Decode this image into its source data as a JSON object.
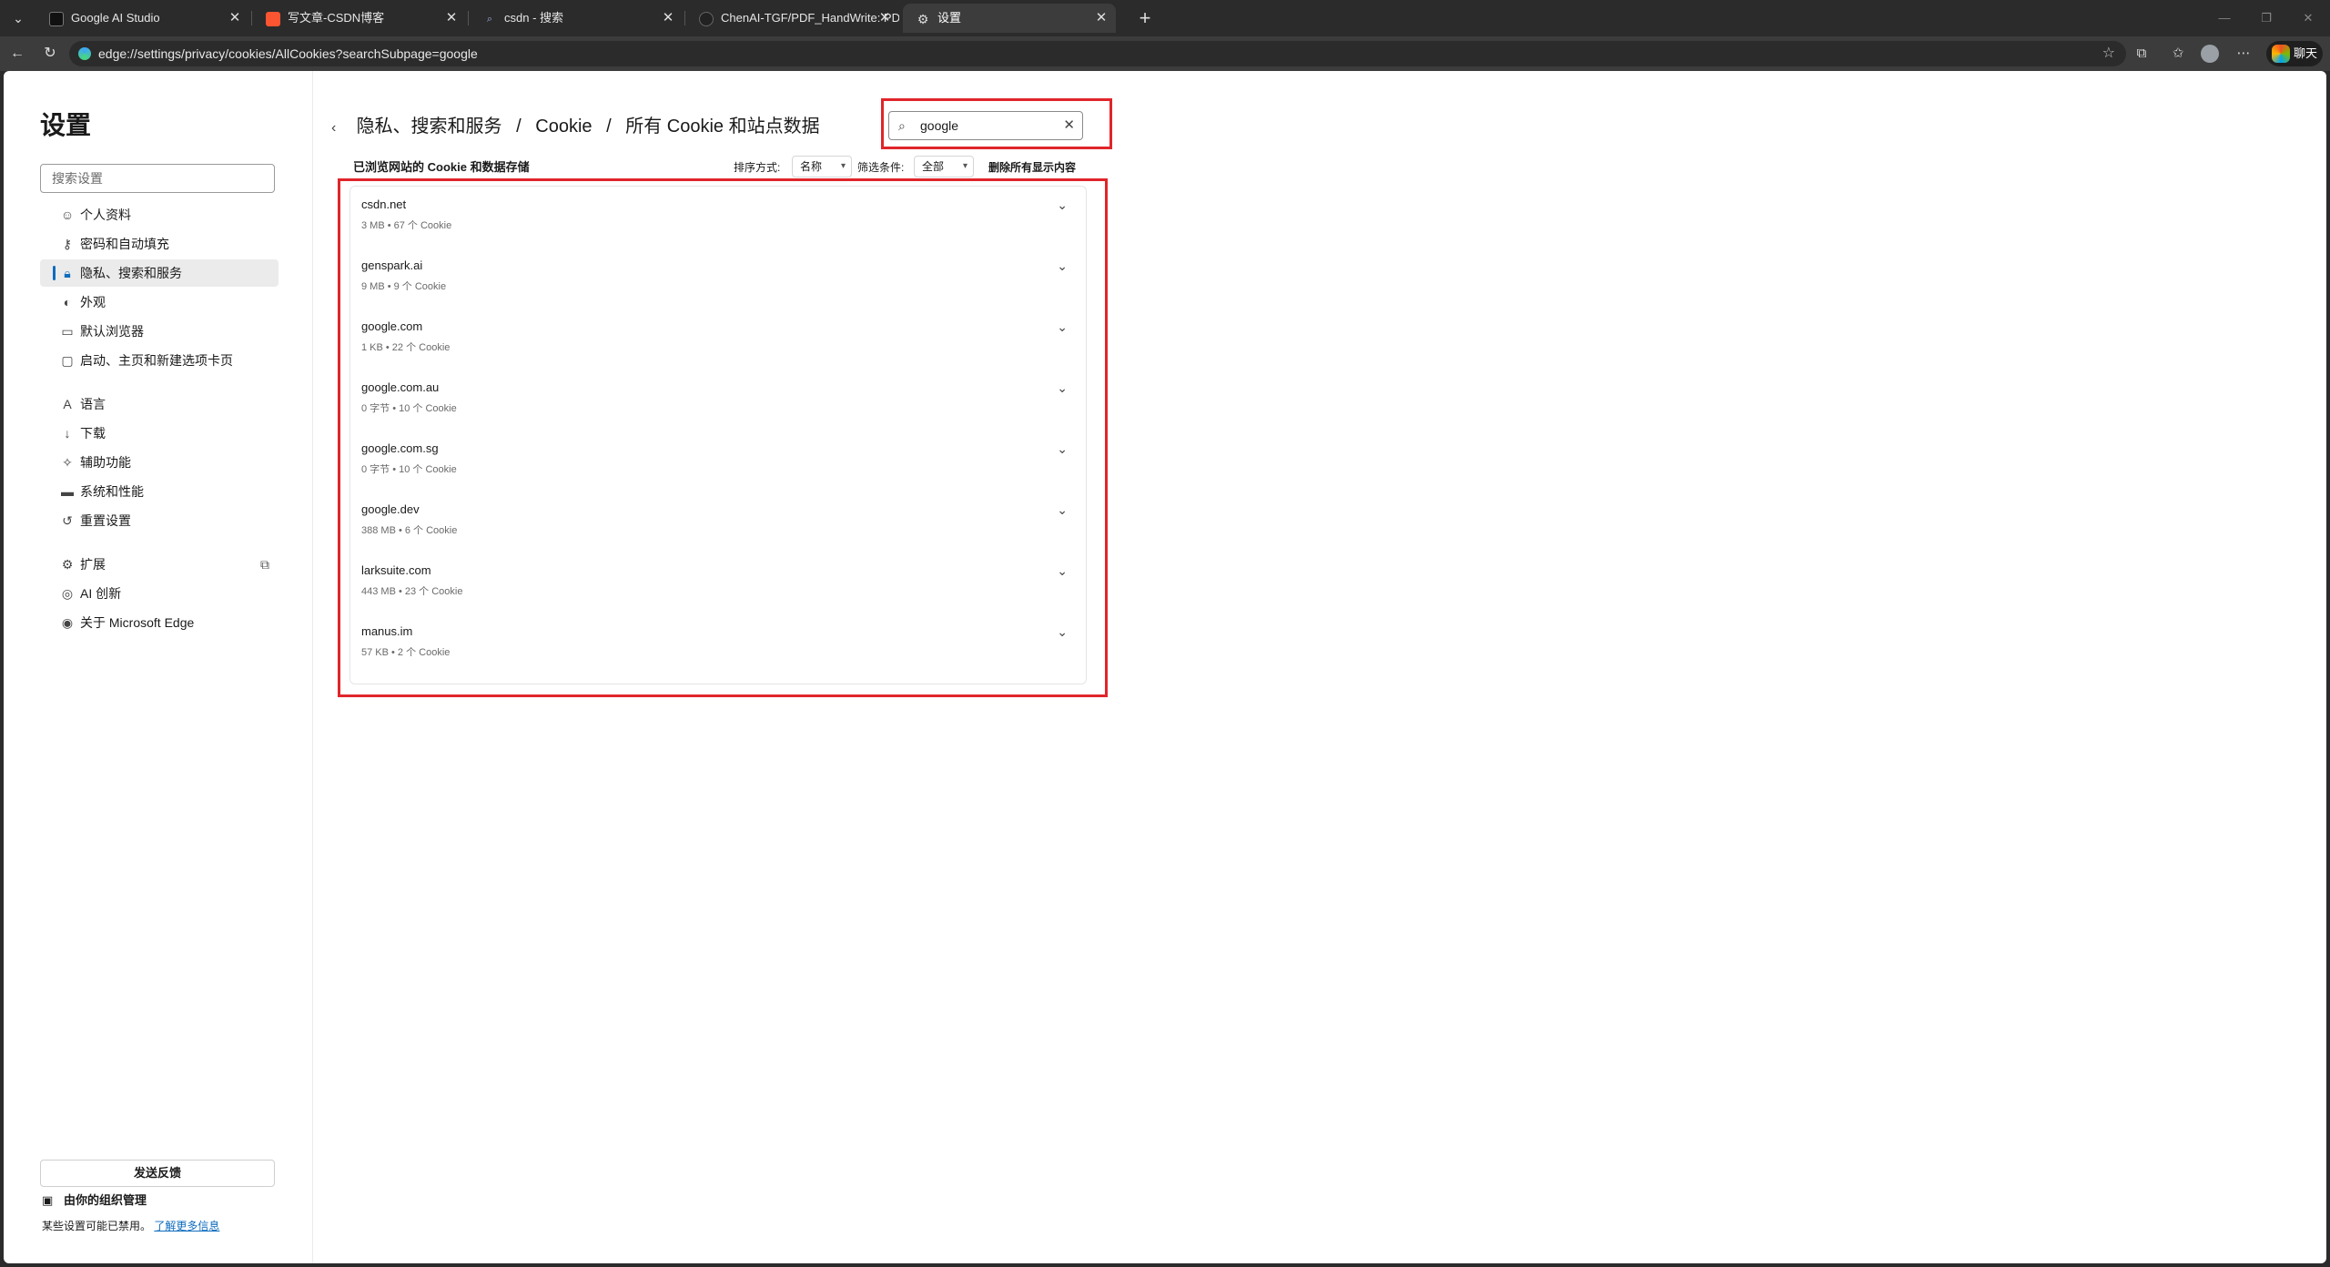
{
  "browser": {
    "tabs": [
      {
        "title": "Google AI Studio",
        "favicon_color": "#111111"
      },
      {
        "title": "写文章-CSDN博客",
        "favicon_color": "#fc5531"
      },
      {
        "title": "csdn - 搜索",
        "favicon_color": "#3c3c3c"
      },
      {
        "title": "ChenAI-TGF/PDF_HandWrite: PDF",
        "favicon_color": "#3c3c3c"
      },
      {
        "title": "设置",
        "favicon_color": "#3c3c3c"
      }
    ],
    "url": "edge://settings/privacy/cookies/AllCookies?searchSubpage=google",
    "chat_label": "聊天"
  },
  "sidebar": {
    "title": "设置",
    "search_placeholder": "搜索设置",
    "items": [
      {
        "label": "个人资料",
        "icon": "profile-icon"
      },
      {
        "label": "密码和自动填充",
        "icon": "key-icon"
      },
      {
        "label": "隐私、搜索和服务",
        "icon": "lock-icon"
      },
      {
        "label": "外观",
        "icon": "palette-icon"
      },
      {
        "label": "默认浏览器",
        "icon": "browser-icon"
      },
      {
        "label": "启动、主页和新建选项卡页",
        "icon": "home-icon"
      },
      {
        "label": "语言",
        "icon": "language-icon"
      },
      {
        "label": "下载",
        "icon": "download-icon"
      },
      {
        "label": "辅助功能",
        "icon": "accessibility-icon"
      },
      {
        "label": "系统和性能",
        "icon": "laptop-icon"
      },
      {
        "label": "重置设置",
        "icon": "reset-icon"
      },
      {
        "label": "扩展",
        "icon": "extensions-icon"
      },
      {
        "label": "AI 创新",
        "icon": "ai-icon"
      },
      {
        "label": "关于 Microsoft Edge",
        "icon": "edge-icon"
      }
    ],
    "feedback_label": "发送反馈",
    "org_managed_label": "由你的组织管理",
    "disabled_note": "某些设置可能已禁用。",
    "learn_more_label": "了解更多信息"
  },
  "main": {
    "breadcrumb": [
      "隐私、搜索和服务",
      "Cookie",
      "所有 Cookie 和站点数据"
    ],
    "search_value": "google",
    "section_title": "已浏览网站的 Cookie 和数据存储",
    "sort_label": "排序方式:",
    "sort_value": "名称",
    "filter_label": "筛选条件:",
    "filter_value": "全部",
    "delete_all_label": "删除所有显示内容",
    "sites": [
      {
        "domain": "csdn.net",
        "meta": "3 MB • 67 个 Cookie"
      },
      {
        "domain": "genspark.ai",
        "meta": "9 MB • 9 个 Cookie"
      },
      {
        "domain": "google.com",
        "meta": "1 KB • 22 个 Cookie"
      },
      {
        "domain": "google.com.au",
        "meta": "0 字节 • 10 个 Cookie"
      },
      {
        "domain": "google.com.sg",
        "meta": "0 字节 • 10 个 Cookie"
      },
      {
        "domain": "google.dev",
        "meta": "388 MB • 6 个 Cookie"
      },
      {
        "domain": "larksuite.com",
        "meta": "443 MB • 23 个 Cookie"
      },
      {
        "domain": "manus.im",
        "meta": "57 KB • 2 个 Cookie"
      }
    ]
  },
  "annotation_color": "#e0252b",
  "accent_color": "#0f6cbd"
}
